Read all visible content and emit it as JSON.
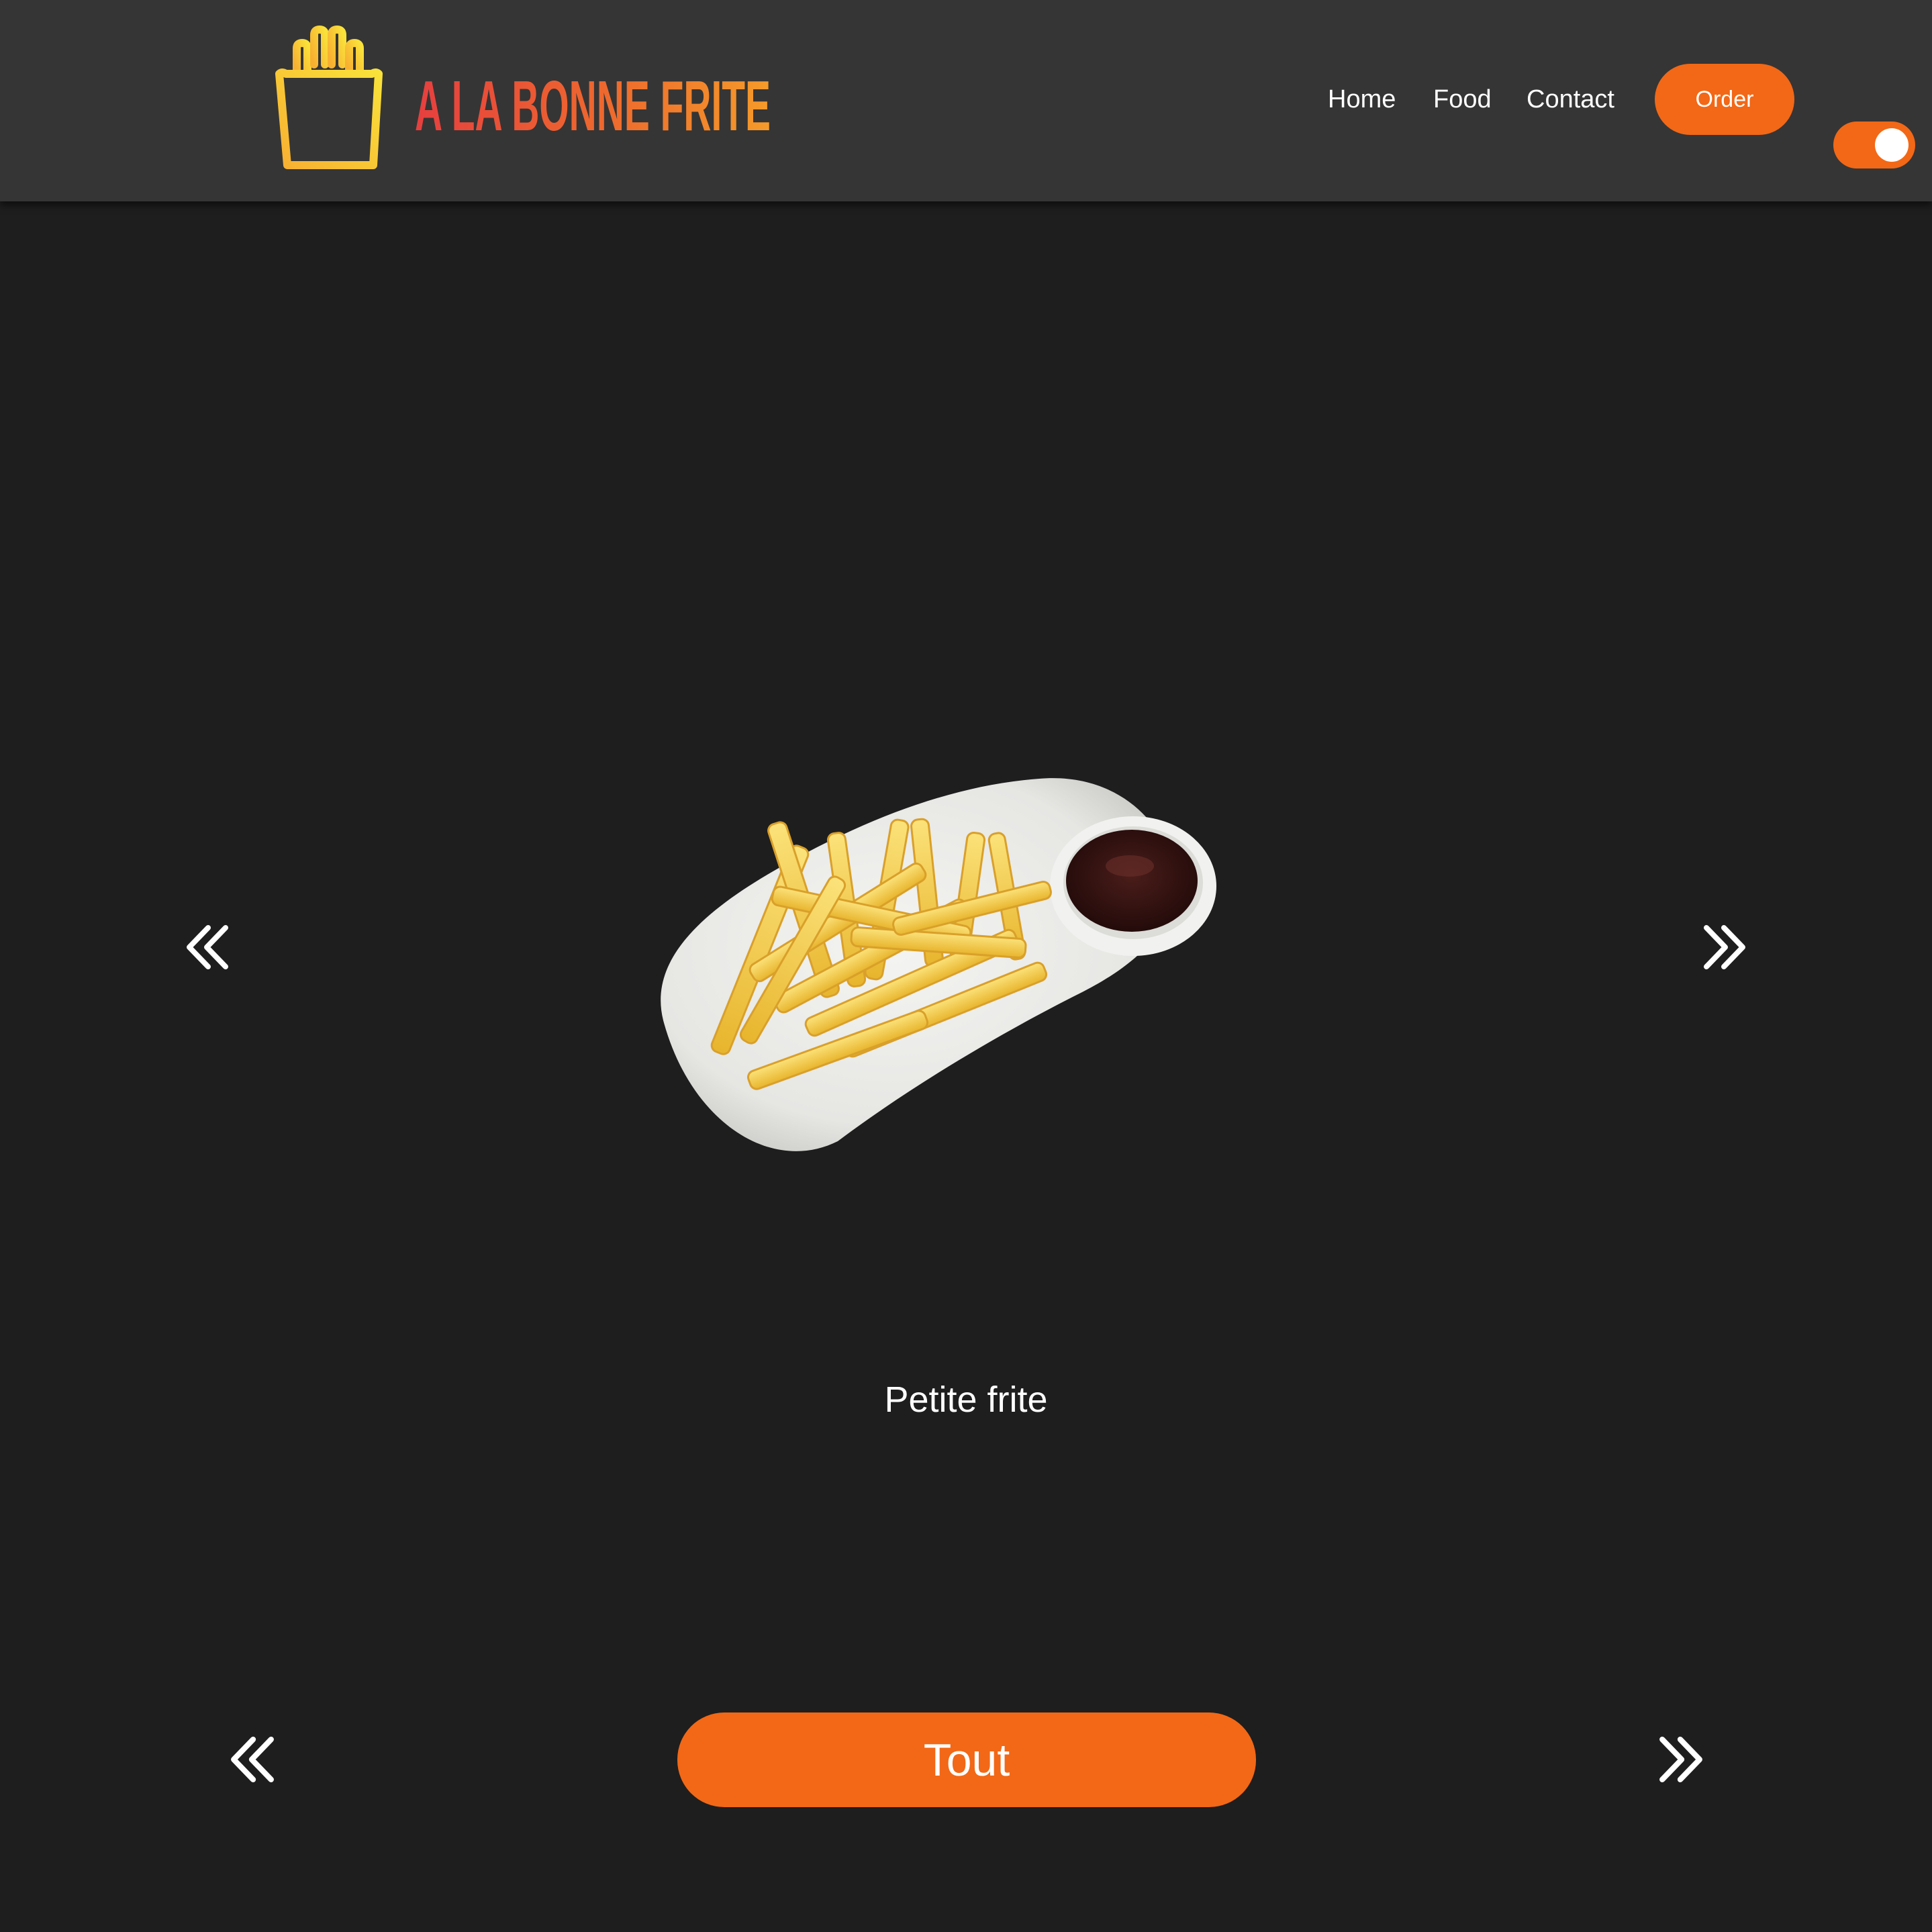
{
  "brand": {
    "logo_text": "A LA BONNE FRITE"
  },
  "nav": {
    "links": [
      {
        "label": "Home"
      },
      {
        "label": "Food"
      },
      {
        "label": "Contact"
      }
    ],
    "order_label": "Order",
    "theme_toggle_on": true
  },
  "carousel": {
    "product_name": "Petite frite",
    "image": "fries-with-sauce-plate",
    "prev_icon": "double-chevron-left-icon",
    "next_icon": "double-chevron-right-icon"
  },
  "category_selector": {
    "label": "Tout",
    "prev_icon": "double-chevron-left-icon",
    "next_icon": "double-chevron-right-icon"
  },
  "colors": {
    "accent": "#f26816",
    "header_bg": "#353535",
    "page_bg": "#1e1e1e",
    "logo_yellow": "#f9d423",
    "logo_orange": "#f26816",
    "logo_red": "#e83a3a"
  }
}
